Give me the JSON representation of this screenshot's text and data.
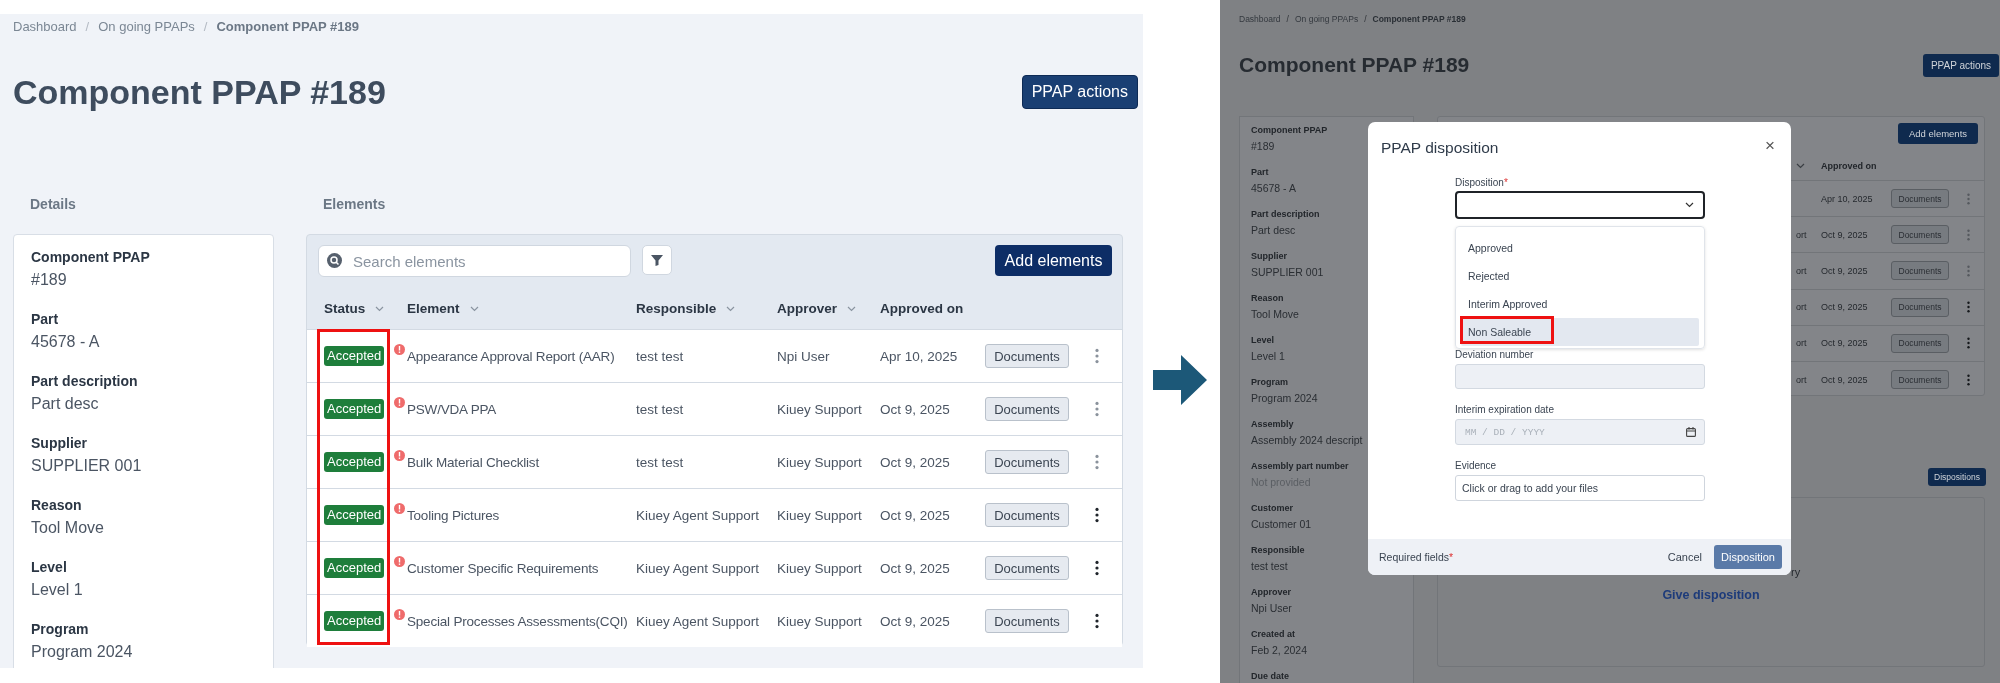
{
  "left": {
    "breadcrumb": [
      {
        "kind": "link",
        "label": "Dashboard"
      },
      {
        "kind": "separator",
        "label": "/"
      },
      {
        "kind": "link",
        "label": "On going PPAPs"
      },
      {
        "kind": "separator",
        "label": "/"
      },
      {
        "kind": "current",
        "label": "Component PPAP #189"
      }
    ],
    "title": "Component PPAP #189",
    "actions_button": "PPAP actions",
    "details_heading": "Details",
    "elements_heading": "Elements",
    "details": [
      {
        "label": "Component PPAP",
        "value": "#189"
      },
      {
        "label": "Part",
        "value": "45678 - A"
      },
      {
        "label": "Part description",
        "value": "Part desc"
      },
      {
        "label": "Supplier",
        "value": "SUPPLIER 001"
      },
      {
        "label": "Reason",
        "value": "Tool Move"
      },
      {
        "label": "Level",
        "value": "Level 1"
      },
      {
        "label": "Program",
        "value": "Program 2024"
      }
    ],
    "search": {
      "placeholder": "Search elements"
    },
    "add_button": "Add elements",
    "columns": [
      {
        "label": "Status",
        "sortable": true
      },
      {
        "label": "Element",
        "sortable": true
      },
      {
        "label": "Responsible",
        "sortable": true
      },
      {
        "label": "Approver",
        "sortable": true
      },
      {
        "label": "Approved on",
        "sortable": false
      }
    ],
    "status_column_highlighted": true,
    "rows": [
      {
        "status": "Accepted",
        "alert": true,
        "element": "Appearance Approval Report (AAR)",
        "responsible": "test test",
        "approver": "Npi User",
        "approved_on": "Apr 10, 2025",
        "documents": "Documents",
        "menu_disabled": true
      },
      {
        "status": "Accepted",
        "alert": true,
        "element": "PSW/VDA PPA",
        "responsible": "test test",
        "approver": "Kiuey Support",
        "approved_on": "Oct 9, 2025",
        "documents": "Documents",
        "menu_disabled": true
      },
      {
        "status": "Accepted",
        "alert": true,
        "element": "Bulk Material Checklist",
        "responsible": "test test",
        "approver": "Kiuey Support",
        "approved_on": "Oct 9, 2025",
        "documents": "Documents",
        "menu_disabled": true
      },
      {
        "status": "Accepted",
        "alert": true,
        "element": "Tooling Pictures",
        "responsible": "Kiuey Agent Support",
        "approver": "Kiuey Support",
        "approved_on": "Oct 9, 2025",
        "documents": "Documents",
        "menu_disabled": false
      },
      {
        "status": "Accepted",
        "alert": true,
        "element": "Customer Specific Requirements",
        "responsible": "Kiuey Agent Support",
        "approver": "Kiuey Support",
        "approved_on": "Oct 9, 2025",
        "documents": "Documents",
        "menu_disabled": false
      },
      {
        "status": "Accepted",
        "alert": true,
        "element": "Special Processes Assessments(CQI)",
        "responsible": "Kiuey Agent Support",
        "approver": "Kiuey Support",
        "approved_on": "Oct 9, 2025",
        "documents": "Documents",
        "menu_disabled": false
      }
    ]
  },
  "right": {
    "breadcrumb": [
      {
        "kind": "link",
        "label": "Dashboard"
      },
      {
        "kind": "separator",
        "label": "/"
      },
      {
        "kind": "link",
        "label": "On going PPAPs"
      },
      {
        "kind": "separator",
        "label": "/"
      },
      {
        "kind": "current",
        "label": "Component PPAP #189"
      }
    ],
    "title": "Component PPAP #189",
    "actions_button": "PPAP actions",
    "details": [
      {
        "label": "Component PPAP",
        "value": "#189",
        "muted": false
      },
      {
        "label": "Part",
        "value": "45678 - A",
        "muted": false
      },
      {
        "label": "Part description",
        "value": "Part desc",
        "muted": false
      },
      {
        "label": "Supplier",
        "value": "SUPPLIER 001",
        "muted": false
      },
      {
        "label": "Reason",
        "value": "Tool Move",
        "muted": false
      },
      {
        "label": "Level",
        "value": "Level 1",
        "muted": false
      },
      {
        "label": "Program",
        "value": "Program 2024",
        "muted": false
      },
      {
        "label": "Assembly",
        "value": "Assembly 2024 descript",
        "muted": false
      },
      {
        "label": "Assembly part number",
        "value": "Not provided",
        "muted": true
      },
      {
        "label": "Customer",
        "value": "Customer 01",
        "muted": false
      },
      {
        "label": "Responsible",
        "value": "test test",
        "muted": false
      },
      {
        "label": "Approver",
        "value": "Npi User",
        "muted": false
      },
      {
        "label": "Created at",
        "value": "Feb 2, 2024",
        "muted": false
      },
      {
        "label": "Due date"
      }
    ],
    "add_button": "Add elements",
    "approved_on_heading": "Approved on",
    "rows": [
      {
        "approved_on": "Apr 10, 2025",
        "documents": "Documents",
        "menu_disabled": true
      },
      {
        "approver": "ort",
        "approved_on": "Oct 9, 2025",
        "documents": "Documents",
        "menu_disabled": true
      },
      {
        "approver": "ort",
        "approved_on": "Oct 9, 2025",
        "documents": "Documents",
        "menu_disabled": true
      },
      {
        "approver": "ort",
        "approved_on": "Oct 9, 2025",
        "documents": "Documents",
        "menu_disabled": false
      },
      {
        "approver": "ort",
        "approved_on": "Oct 9, 2025",
        "documents": "Documents",
        "menu_disabled": false
      },
      {
        "approver": "ort",
        "approved_on": "Oct 9, 2025",
        "documents": "Documents",
        "menu_disabled": false
      }
    ],
    "dispositions_button": "Dispositions",
    "card_text": "ry",
    "give_disposition": "Give disposition"
  },
  "modal": {
    "title": "PPAP disposition",
    "close": "×",
    "disposition": {
      "label": "Disposition",
      "required_mark": "*",
      "options": [
        {
          "label": "Approved",
          "selected": false,
          "annotated": false
        },
        {
          "label": "Rejected",
          "selected": false,
          "annotated": false
        },
        {
          "label": "Interim Approved",
          "selected": false,
          "annotated": false
        },
        {
          "label": "Non Saleable",
          "selected": true,
          "annotated": true
        }
      ]
    },
    "deviation_number": {
      "label": "Deviation number",
      "disabled": true
    },
    "expiration_date": {
      "label": "Interim expiration date",
      "placeholder": "MM / DD / YYYY",
      "disabled": true
    },
    "evidence": {
      "label": "Evidence",
      "prompt": "Click or drag to add your files"
    },
    "required_note": "Required fields",
    "required_note_mark": "*",
    "cancel": "Cancel",
    "submit": "Disposition"
  }
}
